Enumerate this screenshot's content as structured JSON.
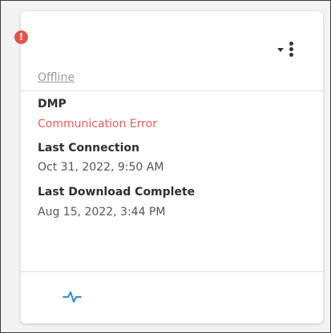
{
  "card": {
    "status_link": "Offline",
    "device_label": "DMP",
    "device_status": "Communication Error",
    "last_connection_label": "Last Connection",
    "last_connection_value": "Oct 31, 2022, 9:50 AM",
    "last_download_label": "Last Download Complete",
    "last_download_value": "Aug 15, 2022, 3:44 PM",
    "alert_badge": "!",
    "icons": {
      "alert": "exclamation-circle-icon",
      "menu_caret": "chevron-down-icon",
      "menu_dots": "vertical-dots-icon",
      "activity": "pulse-icon"
    }
  },
  "colors": {
    "alert": "#e8524a",
    "error_text": "#ef5b57",
    "activity_icon": "#2f8fdd"
  }
}
